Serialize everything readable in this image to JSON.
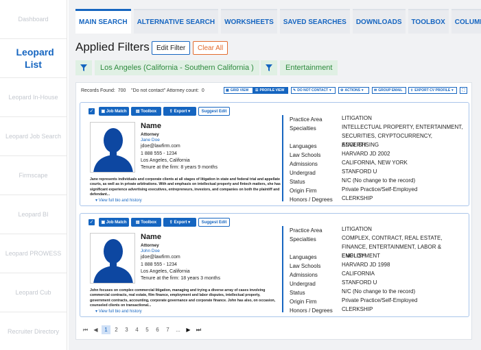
{
  "sidebar": {
    "items": [
      {
        "label": "Dashboard"
      },
      {
        "label": "Leopard List",
        "active": true
      },
      {
        "label": "Leopard In-House"
      },
      {
        "label": "Leopard Job Search"
      },
      {
        "label": "Firmscape"
      },
      {
        "label": "Leopard BI"
      },
      {
        "label": "Leopard PROWESS"
      },
      {
        "label": "Leopard Cub"
      },
      {
        "label": "Recruiter Directory"
      }
    ]
  },
  "tabs": [
    "MAIN SEARCH",
    "ALTERNATIVE SEARCH",
    "WORKSHEETS",
    "SAVED SEARCHES",
    "DOWNLOADS",
    "TOOLBOX",
    "COLUMN SETTINGS"
  ],
  "applied_filters": {
    "title": "Applied Filters",
    "edit_label": "Edit Filter",
    "clear_label": "Clear All",
    "chips": [
      "Los Angeles (California - Southern California )",
      "Entertainment"
    ]
  },
  "results": {
    "records_found_label": "Records Found:",
    "records_found": "700",
    "dnc_label": "\"Do not contact\" Attorney count:",
    "dnc_count": "0"
  },
  "toolbar": {
    "grid_view": "GRID VIEW",
    "profile_view": "PROFILE VIEW",
    "do_not_contact": "DO NOT CONTACT",
    "actions": "ACTIONS",
    "group_email": "GROUP EMAIL",
    "export_cv": "EXPORT CV PROFILE"
  },
  "card_buttons": {
    "job_match": "Job Match",
    "toolbox": "Toolbox",
    "export": "Export",
    "suggest_edit": "Suggest Edit"
  },
  "detail_labels": [
    "Practice Area",
    "Specialties",
    "Languages",
    "Law Schools",
    "Admissions",
    "Undergrad",
    "Status",
    "Origin Firm",
    "Honors / Degrees"
  ],
  "view_full": "View full bio and history",
  "attorneys": [
    {
      "name": "Name",
      "title": "Attorney",
      "display_name": "Jane Doe",
      "email": "jdoe@lawfirm.com",
      "phone": "1 888 555 - 1234",
      "location": "Los Angeles, California",
      "tenure": "Tenure at the firm: 8 years 9 months",
      "bio": "Jane represents individuals and corporate clients at all stages of litigation in state and federal trial and appellate courts, as well as in private arbitrations. With and emphasis on intellectual property and fintech matters, she has significant experience advertising executives, entrepreneurs, investors, and companies on both the plaintiff and defendant...",
      "details": [
        "LITIGATION",
        "INTELLECTUAL PROPERTY, ENTERTAINMENT, SECURITIES, CRYPTOCURRENCY, ADVERTISING",
        "ENGLISH",
        "HARVARD JD 2002",
        "CALIFORNIA, NEW YORK",
        "STANFORD U",
        "N/C (No change to the record)",
        "Private Practice/Self-Employed",
        "CLERKSHIP"
      ]
    },
    {
      "name": "Name",
      "title": "Attorney",
      "display_name": "John Doe",
      "email": "jdoe@lawfirm.com",
      "phone": "1 888 555 - 1234",
      "location": "Los Angeles, California",
      "tenure": "Tenure at the firm: 18 years 3 months",
      "bio": "John focuses on complex commercial litigation, managing and trying a diverse array of cases involving commercial contracts, real estate, film finance, employment and labor disputes, intellectual property, government contracts, accounting, corporate governance and corporate finance. John has also, on occasion, counseled clients on transactional...",
      "details": [
        "LITIGATION",
        "COMPLEX, CONTRACT, REAL ESTATE, FINANCE, ENTERTAINMENT, LABOR & EMPLOYMENT",
        "ENGLISH",
        "HARVARD JD 1998",
        "CALIFORNIA",
        "STANFORD U",
        "N/C (No change to the record)",
        "Private Practice/Self-Employed",
        "CLERKSHIP"
      ]
    }
  ],
  "pagination": {
    "pages": [
      "1",
      "2",
      "3",
      "4",
      "5",
      "6",
      "7",
      "..."
    ],
    "current": "1"
  },
  "colors": {
    "accent": "#1565c0",
    "filter_green": "#2e8b3e",
    "filter_bg": "#e0f0e4",
    "clear_orange": "#e26a2c"
  }
}
